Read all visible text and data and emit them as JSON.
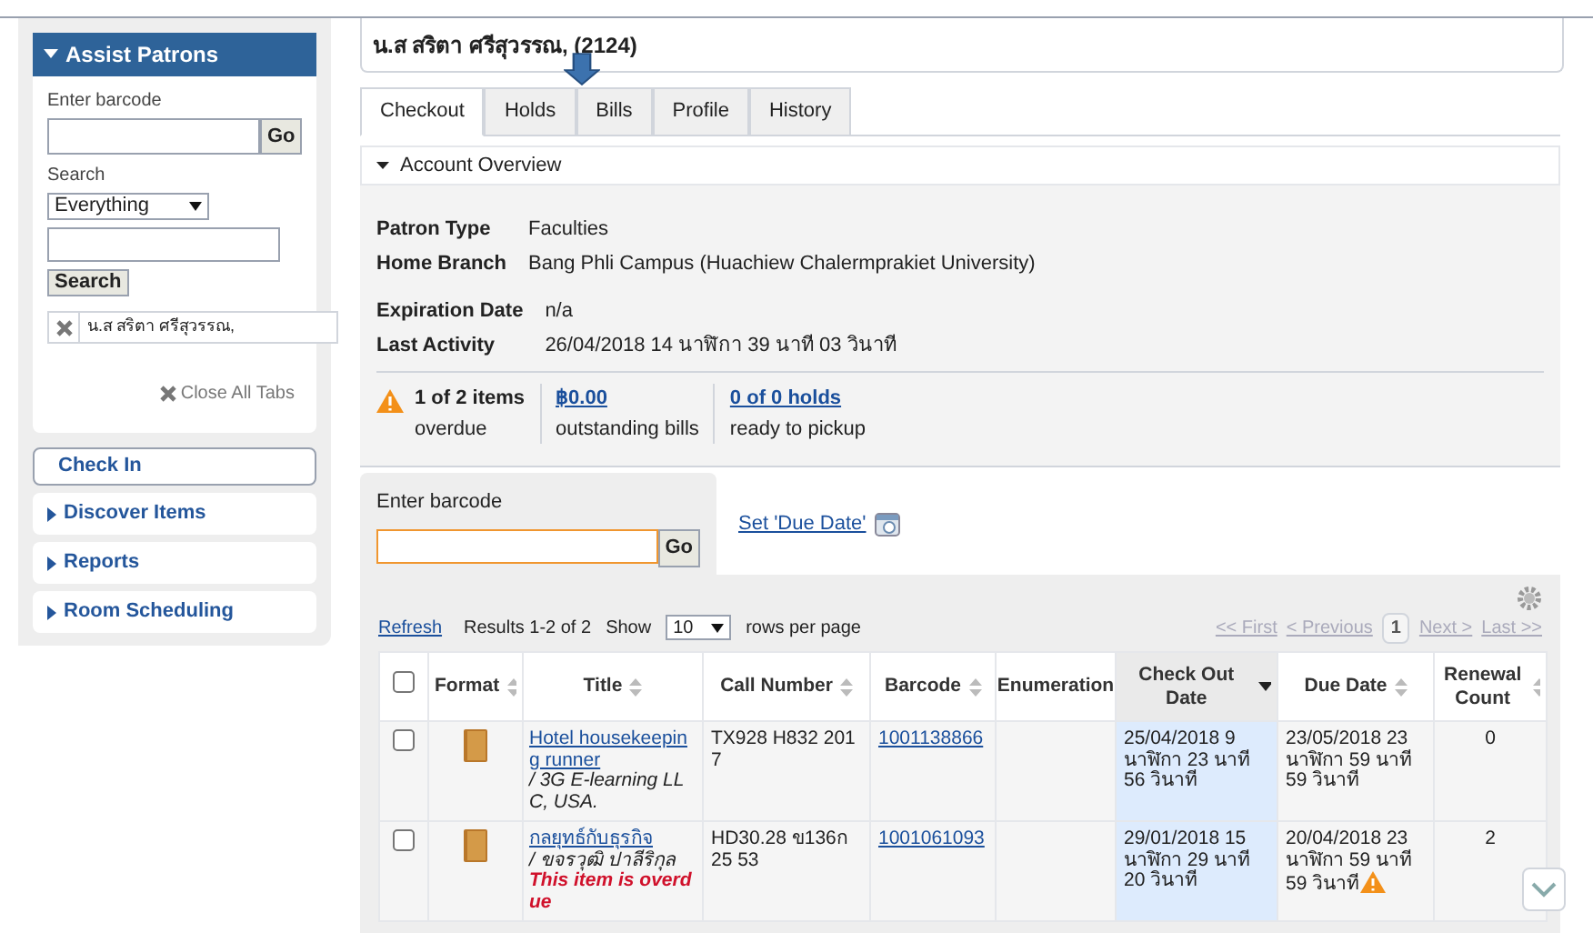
{
  "sidebar": {
    "title": "Assist Patrons",
    "barcode_label": "Enter barcode",
    "go_button": "Go",
    "search_label": "Search",
    "search_scope": "Everything",
    "search_button": "Search",
    "open_patron": "น.ส สริตา ศรีสุวรรณ,",
    "close_all": "Close All Tabs",
    "nav": [
      {
        "label": "Check In",
        "kind": "button"
      },
      {
        "label": "Discover Items",
        "kind": "section"
      },
      {
        "label": "Reports",
        "kind": "section"
      },
      {
        "label": "Room Scheduling",
        "kind": "section"
      }
    ]
  },
  "patron_name": "น.ส สริตา ศรีสุวรรณ, (2124)",
  "tabs": [
    {
      "label": "Checkout",
      "selected": true
    },
    {
      "label": "Holds",
      "selected": false
    },
    {
      "label": "Bills",
      "selected": false
    },
    {
      "label": "Profile",
      "selected": false
    },
    {
      "label": "History",
      "selected": false
    }
  ],
  "overview": {
    "title": "Account Overview",
    "expanded": true,
    "fields": [
      {
        "label": "Patron Type",
        "value": "Faculties"
      },
      {
        "label": "Home Branch",
        "value": "Bang Phli Campus (Huachiew Chalermprakiet University)"
      },
      {
        "label": "Expiration Date",
        "value": "n/a"
      },
      {
        "label": "Last Activity",
        "value": "26/04/2018 14 นาฬิกา 39 นาที 03 วินาที"
      }
    ],
    "summary": [
      {
        "kind": "warning",
        "value": "1 of 2 items",
        "caption": "overdue"
      },
      {
        "kind": "link",
        "value": "฿0.00",
        "caption": "outstanding bills"
      },
      {
        "kind": "link",
        "value": "0 of 0 holds",
        "caption": "ready to pickup"
      }
    ]
  },
  "checkout": {
    "barcode_label": "Enter barcode",
    "go_button": "Go",
    "due_date_link": "Set 'Due Date'"
  },
  "table": {
    "refresh": "Refresh",
    "results": "Results 1-2 of 2",
    "show_label": "Show",
    "rows_per_page": "10",
    "rows_per_page_label": "rows per page",
    "select_all_checked": false,
    "pager": {
      "first": "<< First",
      "previous": "< Previous",
      "page": "1",
      "next": "Next >",
      "last": "Last >>"
    },
    "columns": [
      {
        "label": "Format",
        "sorted": false
      },
      {
        "label": "Title",
        "sorted": false
      },
      {
        "label": "Call Number",
        "sorted": false
      },
      {
        "label": "Barcode",
        "sorted": false
      },
      {
        "label": "Enumeration"
      },
      {
        "label": "Check Out Date",
        "sorted": true
      },
      {
        "label": "Due Date",
        "sorted": false
      },
      {
        "label": "Renewal Count",
        "sorted": false
      }
    ],
    "rows": [
      {
        "checked": false,
        "title": "Hotel housekeeping runner",
        "author": " / 3G E-learning LLC, USA.",
        "call_number": "TX928 H832 2017",
        "barcode": "1001138866",
        "enumeration": "",
        "check_out": "25/04/2018 9 นาฬิกา 23 นาที 56 วินาที",
        "due": "23/05/2018 23 นาฬิกา 59 นาที 59 วินาที",
        "overdue": false,
        "renewals": "0"
      },
      {
        "checked": false,
        "title": "กลยุทธ์กับธุรกิจ",
        "author": " / ขจรวุฒิ ปาลีริกุล",
        "overdue_note": "This item is overdue",
        "call_number": "HD30.28 ข136ก 25 53",
        "barcode": "1001061093",
        "enumeration": "",
        "check_out": "29/01/2018 15 นาฬิกา 29 นาที 20 วินาที",
        "due": "20/04/2018 23 นาฬิกา 59 นาที 59 วินาที",
        "overdue": true,
        "renewals": "2"
      }
    ]
  }
}
